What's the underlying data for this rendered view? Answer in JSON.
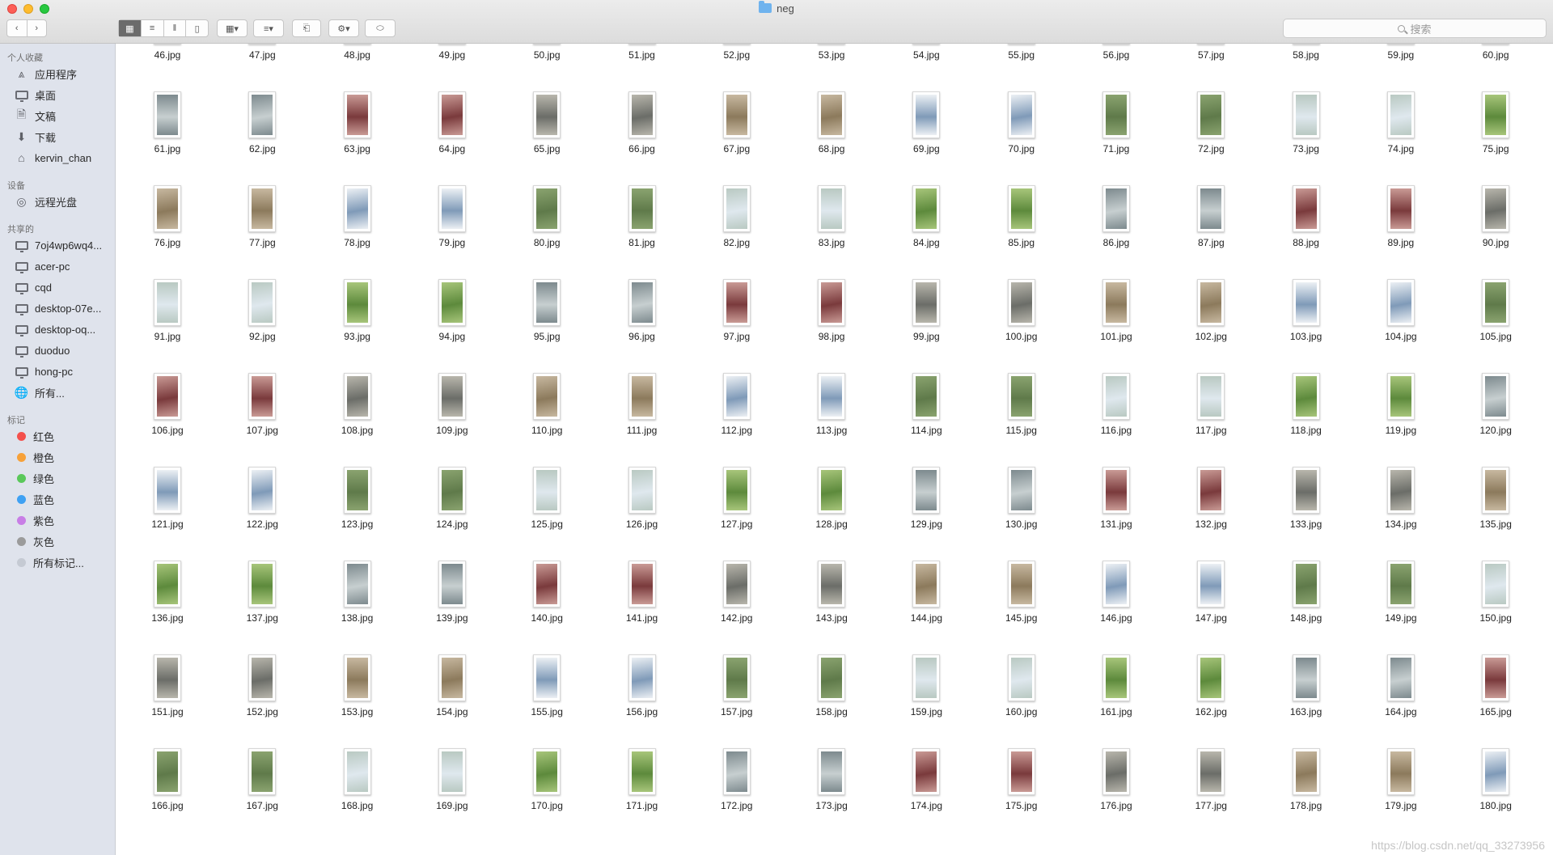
{
  "window": {
    "title": "neg",
    "search_placeholder": "搜索"
  },
  "toolbar": {
    "back_icon": "chevron-left-icon",
    "forward_icon": "chevron-right-icon",
    "view_modes": [
      "icon-view",
      "list-view",
      "column-view",
      "gallery-view"
    ],
    "selected_view": "icon-view"
  },
  "sidebar": {
    "favorites_header": "个人收藏",
    "favorites": [
      {
        "label": "应用程序",
        "icon": "applications-icon"
      },
      {
        "label": "桌面",
        "icon": "desktop-icon"
      },
      {
        "label": "文稿",
        "icon": "documents-icon"
      },
      {
        "label": "下载",
        "icon": "downloads-icon"
      },
      {
        "label": "kervin_chan",
        "icon": "home-icon"
      }
    ],
    "devices_header": "设备",
    "devices": [
      {
        "label": "远程光盘",
        "icon": "disc-icon"
      }
    ],
    "shared_header": "共享的",
    "shared": [
      {
        "label": "7oj4wp6wq4...",
        "icon": "computer-icon"
      },
      {
        "label": "acer-pc",
        "icon": "computer-icon"
      },
      {
        "label": "cqd",
        "icon": "computer-icon"
      },
      {
        "label": "desktop-07e...",
        "icon": "computer-icon"
      },
      {
        "label": "desktop-oq...",
        "icon": "computer-icon"
      },
      {
        "label": "duoduo",
        "icon": "computer-icon"
      },
      {
        "label": "hong-pc",
        "icon": "computer-icon"
      },
      {
        "label": "所有...",
        "icon": "network-icon"
      }
    ],
    "tags_header": "标记",
    "tags": [
      {
        "label": "红色",
        "color": "#f4504c"
      },
      {
        "label": "橙色",
        "color": "#f7a139"
      },
      {
        "label": "绿色",
        "color": "#5ac85a"
      },
      {
        "label": "蓝色",
        "color": "#3fa1f3"
      },
      {
        "label": "紫色",
        "color": "#c87ee6"
      },
      {
        "label": "灰色",
        "color": "#9b9b9b"
      },
      {
        "label": "所有标记...",
        "color": "#c5cad3"
      }
    ]
  },
  "files": [
    "46.jpg",
    "47.jpg",
    "48.jpg",
    "49.jpg",
    "50.jpg",
    "51.jpg",
    "52.jpg",
    "53.jpg",
    "54.jpg",
    "55.jpg",
    "56.jpg",
    "57.jpg",
    "58.jpg",
    "59.jpg",
    "60.jpg",
    "61.jpg",
    "62.jpg",
    "63.jpg",
    "64.jpg",
    "65.jpg",
    "66.jpg",
    "67.jpg",
    "68.jpg",
    "69.jpg",
    "70.jpg",
    "71.jpg",
    "72.jpg",
    "73.jpg",
    "74.jpg",
    "75.jpg",
    "76.jpg",
    "77.jpg",
    "78.jpg",
    "79.jpg",
    "80.jpg",
    "81.jpg",
    "82.jpg",
    "83.jpg",
    "84.jpg",
    "85.jpg",
    "86.jpg",
    "87.jpg",
    "88.jpg",
    "89.jpg",
    "90.jpg",
    "91.jpg",
    "92.jpg",
    "93.jpg",
    "94.jpg",
    "95.jpg",
    "96.jpg",
    "97.jpg",
    "98.jpg",
    "99.jpg",
    "100.jpg",
    "101.jpg",
    "102.jpg",
    "103.jpg",
    "104.jpg",
    "105.jpg",
    "106.jpg",
    "107.jpg",
    "108.jpg",
    "109.jpg",
    "110.jpg",
    "111.jpg",
    "112.jpg",
    "113.jpg",
    "114.jpg",
    "115.jpg",
    "116.jpg",
    "117.jpg",
    "118.jpg",
    "119.jpg",
    "120.jpg",
    "121.jpg",
    "122.jpg",
    "123.jpg",
    "124.jpg",
    "125.jpg",
    "126.jpg",
    "127.jpg",
    "128.jpg",
    "129.jpg",
    "130.jpg",
    "131.jpg",
    "132.jpg",
    "133.jpg",
    "134.jpg",
    "135.jpg",
    "136.jpg",
    "137.jpg",
    "138.jpg",
    "139.jpg",
    "140.jpg",
    "141.jpg",
    "142.jpg",
    "143.jpg",
    "144.jpg",
    "145.jpg",
    "146.jpg",
    "147.jpg",
    "148.jpg",
    "149.jpg",
    "150.jpg",
    "151.jpg",
    "152.jpg",
    "153.jpg",
    "154.jpg",
    "155.jpg",
    "156.jpg",
    "157.jpg",
    "158.jpg",
    "159.jpg",
    "160.jpg",
    "161.jpg",
    "162.jpg",
    "163.jpg",
    "164.jpg",
    "165.jpg",
    "166.jpg",
    "167.jpg",
    "168.jpg",
    "169.jpg",
    "170.jpg",
    "171.jpg",
    "172.jpg",
    "173.jpg",
    "174.jpg",
    "175.jpg",
    "176.jpg",
    "177.jpg",
    "178.jpg",
    "179.jpg",
    "180.jpg"
  ],
  "thumbnail_palette": {
    "trees": [
      "#5f7a4a",
      "#8aa36f"
    ],
    "sky": [
      "#dfe8ee",
      "#b9c9c2"
    ],
    "park": [
      "#5d8a3c",
      "#a7c57a"
    ],
    "facade": [
      "#c7cfd0",
      "#7d8a8e"
    ],
    "red_facade": [
      "#7a3a3c",
      "#c99a95"
    ],
    "street": [
      "#6b6d68",
      "#b8b6ac"
    ],
    "buildings": [
      "#8c7a5c",
      "#c7b8a0"
    ],
    "cloudy": [
      "#7f9ab8",
      "#ecf0f4"
    ]
  },
  "watermark": "https://blog.csdn.net/qq_33273956"
}
